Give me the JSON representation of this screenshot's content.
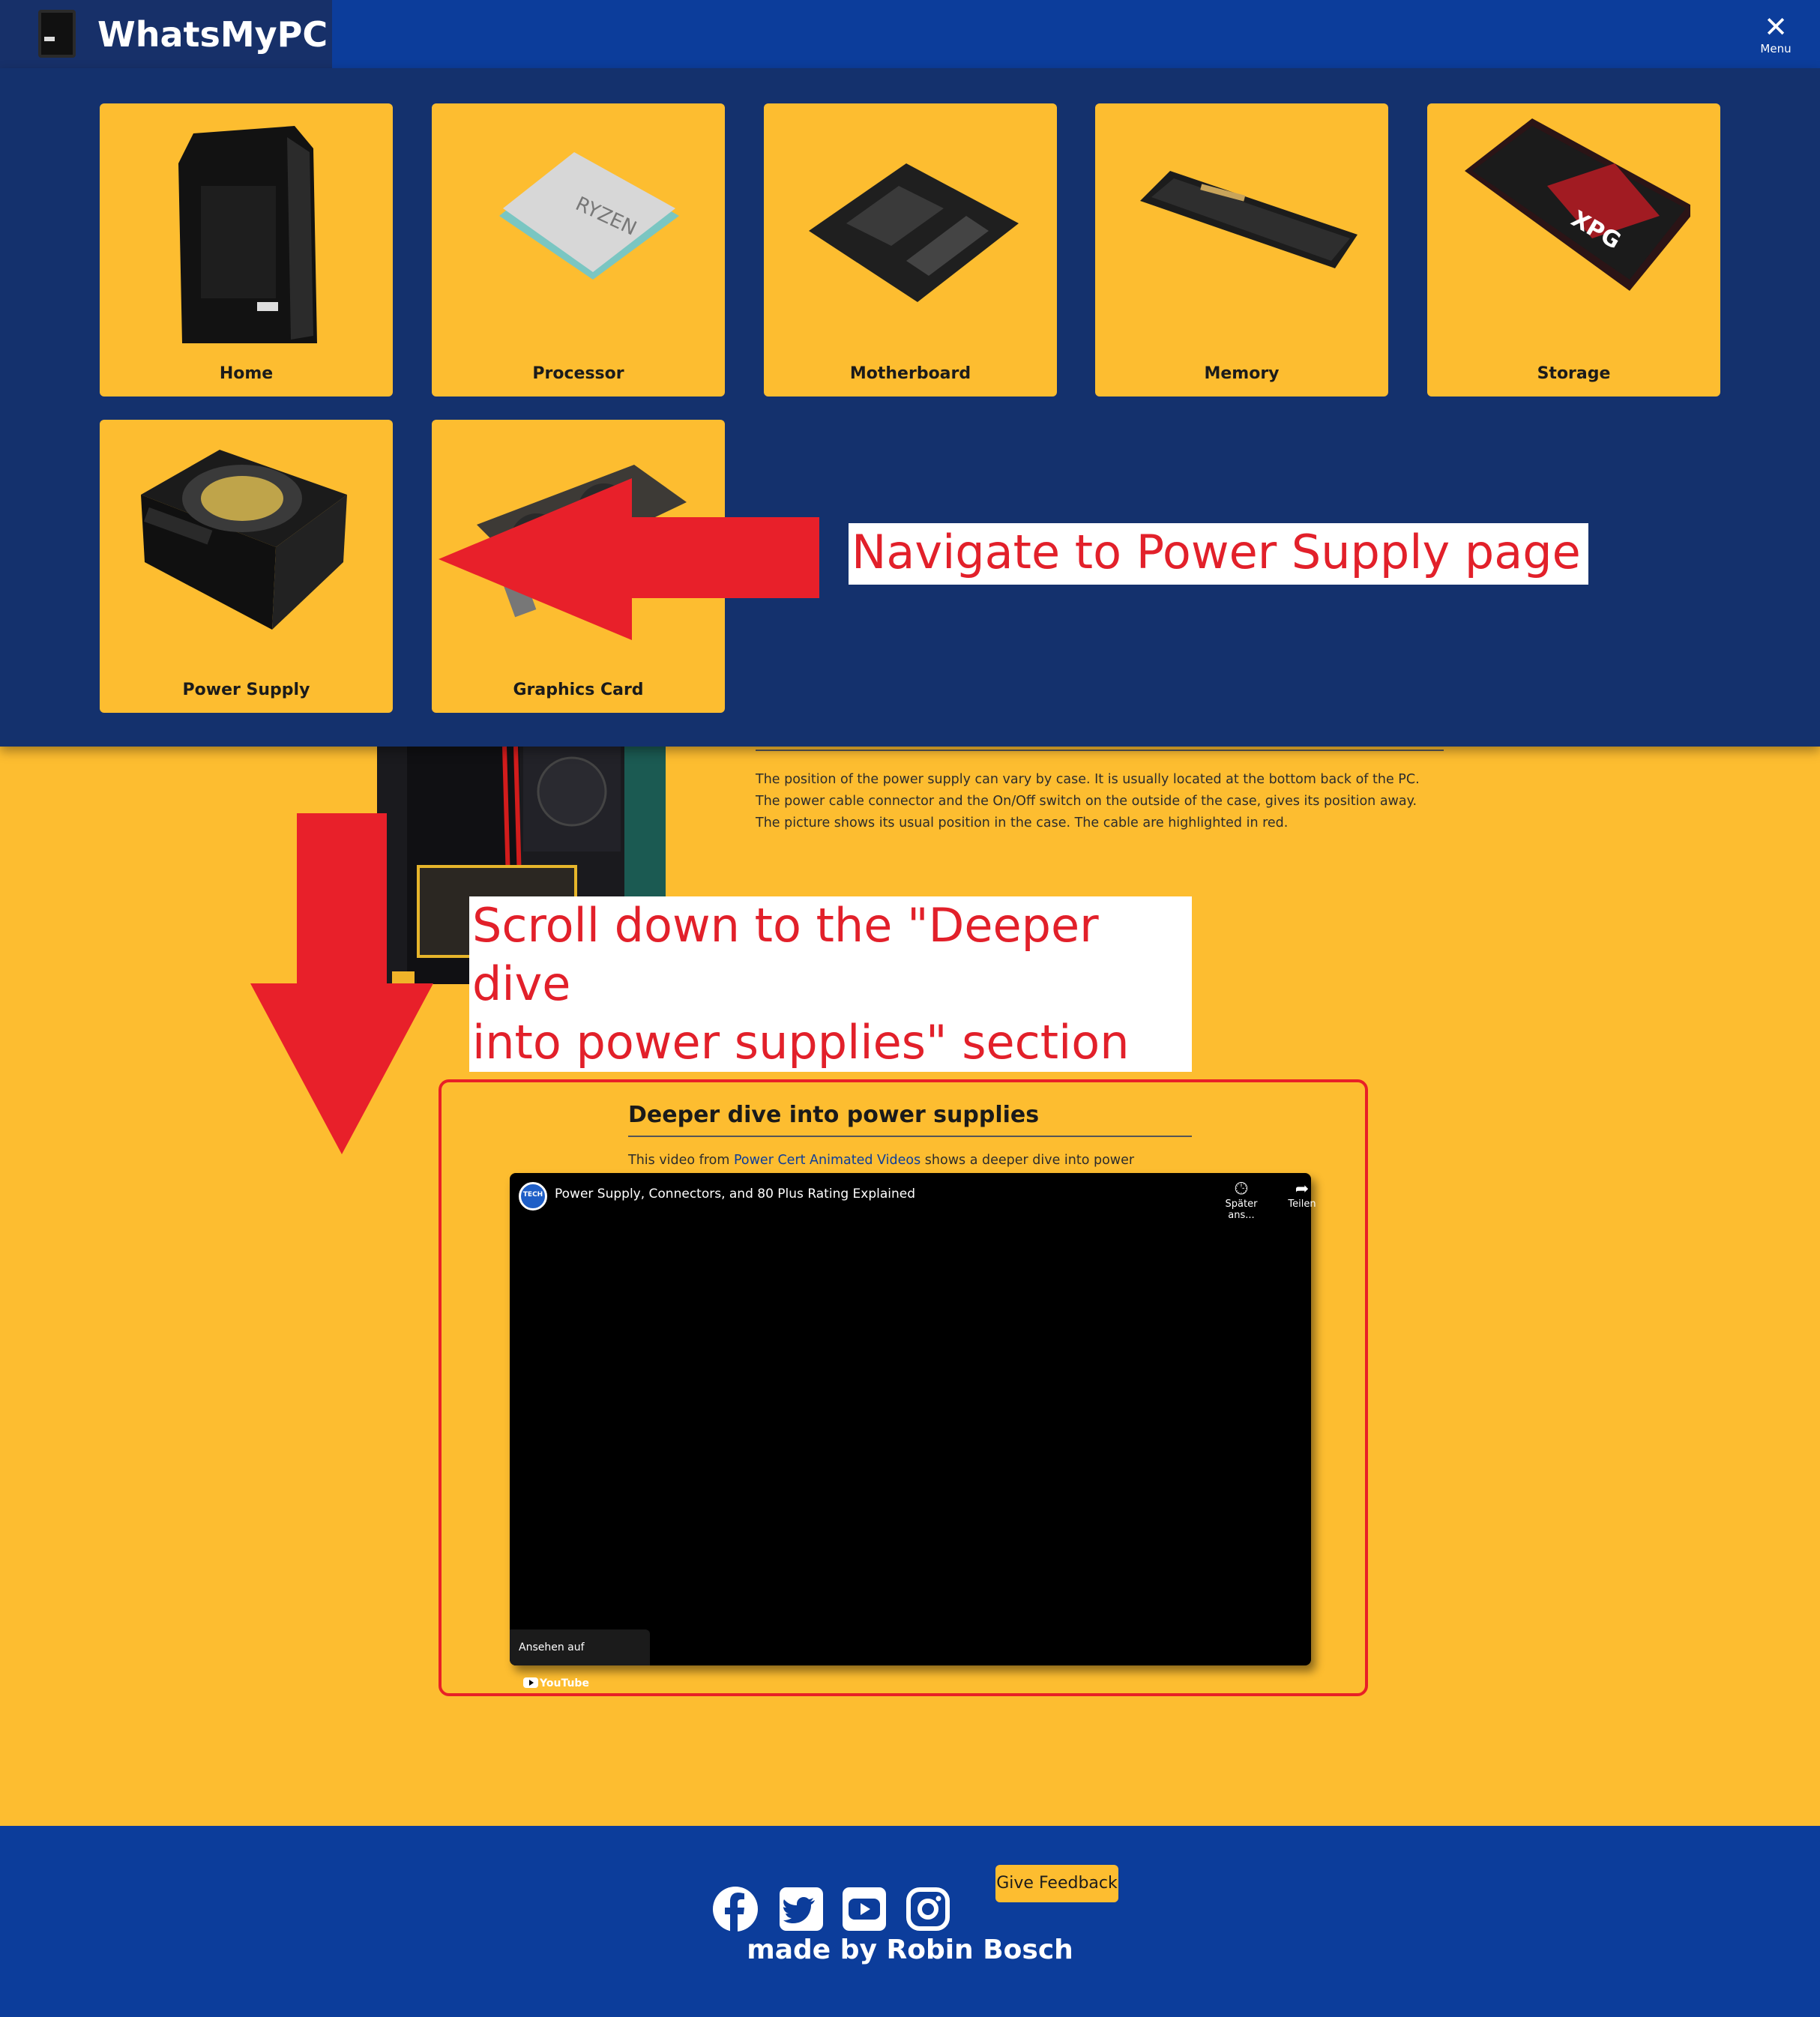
{
  "header": {
    "brand_name": "WhatsMyPC",
    "menu_label": "Menu"
  },
  "nav": {
    "tiles": [
      {
        "label": "Home",
        "icon": "pc-case-icon"
      },
      {
        "label": "Processor",
        "icon": "cpu-icon"
      },
      {
        "label": "Motherboard",
        "icon": "motherboard-icon"
      },
      {
        "label": "Memory",
        "icon": "ram-icon"
      },
      {
        "label": "Storage",
        "icon": "ssd-icon"
      },
      {
        "label": "Power Supply",
        "icon": "psu-icon"
      },
      {
        "label": "Graphics Card",
        "icon": "gpu-icon"
      }
    ]
  },
  "main": {
    "psu_description": "The position of the power supply can vary by case. It is usually located at the bottom back of the PC. The power cable connector and the On/Off switch on the outside of the case, gives its position away. The picture shows its usual position in the case. The cable are highlighted in red.",
    "deeper": {
      "title": "Deeper dive into power supplies",
      "text_before": "This video from ",
      "link": "Power Cert Animated Videos",
      "text_after": " shows a deeper dive into power supplies."
    },
    "video": {
      "title": "Power Supply, Connectors, and 80 Plus Rating Explained",
      "channel_badge": "TECH",
      "watch_later": "Später ans...",
      "share": "Teilen",
      "watch_on": "Ansehen auf",
      "youtube": "YouTube"
    }
  },
  "annotations": {
    "step1": "Navigate to Power Supply page",
    "step2_line1": "Scroll down to the \"Deeper dive",
    "step2_line2": "into power supplies\" section"
  },
  "footer": {
    "social": [
      "facebook-icon",
      "twitter-icon",
      "youtube-icon",
      "instagram-icon"
    ],
    "feedback_label": "Give Feedback",
    "made_by": "made by Robin Bosch"
  },
  "colors": {
    "brand_blue": "#0c3d9b",
    "panel_blue": "#14316d",
    "accent_yellow": "#fdbd30",
    "annotation_red": "#e82026"
  }
}
